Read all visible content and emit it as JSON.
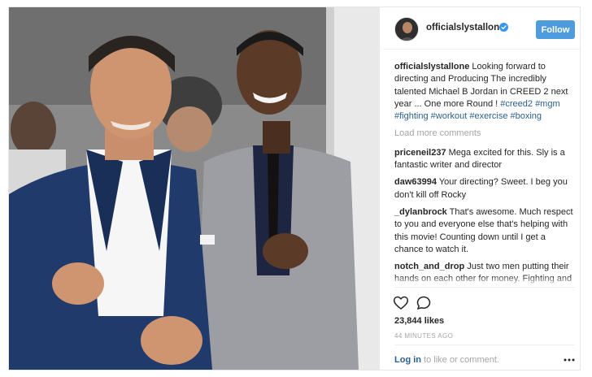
{
  "header": {
    "username": "officialslystallone",
    "follow_label": "Follow"
  },
  "caption": {
    "user": "officialslystallone",
    "text": "Looking forward to directing and Producing The incredibly talented Michael B Jordan in CREED 2 next year ... One more Round ! ",
    "tags": [
      "#creed2",
      "#mgm",
      "#fighting",
      "#workout",
      "#exercise",
      "#boxing"
    ]
  },
  "load_more_label": "Load more comments",
  "comments": [
    {
      "user": "priceneil237",
      "text": "Mega excited for this. Sly is a fantastic writer and director"
    },
    {
      "user": "daw63994",
      "text": "Your directing? Sweet. I beg you don't kill off Rocky"
    },
    {
      "user": "_dylanbrock",
      "text": "That's awesome. Much respect to you and everyone else that's helping with this movie! Counting down until I get a chance to watch it."
    },
    {
      "user": "notch_and_drop",
      "text": "Just two men putting their hands on each other for money. Fighting and fucking is the same thing. Transfer of energy from one to another, see who wins. Just more socially acceptable"
    }
  ],
  "likes": "23,844 likes",
  "timestamp": "44 MINUTES AGO",
  "footer": {
    "login_label": "Log in",
    "rest": " to like or comment."
  },
  "icons": {
    "verified": "verified-badge-icon",
    "like": "heart-icon",
    "comment": "comment-bubble-icon",
    "more": "more-options-icon"
  },
  "colors": {
    "follow_button": "#4e9bde",
    "link": "#2b5f8e",
    "muted": "#a4a4a4",
    "verified": "#3897f0"
  }
}
